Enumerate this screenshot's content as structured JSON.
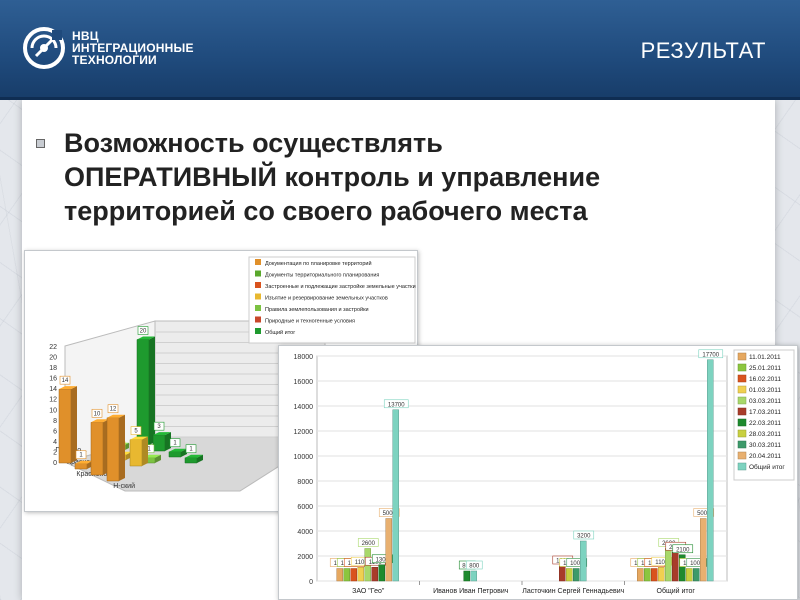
{
  "header": {
    "logo_lines": [
      "НВЦ",
      "ИНТЕГРАЦИОННЫЕ",
      "ТЕХНОЛОГИИ"
    ],
    "title": "РЕЗУЛЬТАТ"
  },
  "bullet": {
    "line1": "Возможность осуществлять",
    "line2_emphasis": "ОПЕРАТИВНЫЙ",
    "line2_rest": " контроль и управление",
    "line3": "территорией со своего рабочего места"
  },
  "chart_data": [
    {
      "type": "bar",
      "title": "",
      "xlabel": "",
      "ylabel": "",
      "ylim": [
        0,
        22
      ],
      "y_ticks": [
        0,
        2,
        4,
        6,
        8,
        10,
        12,
        14,
        16,
        18,
        20,
        22
      ],
      "categories": [
        "Гусиноо...",
        "Краснооз...",
        "Краснопол...",
        "Н-ский"
      ],
      "legend": [
        {
          "name": "Документация по планировке территорий",
          "color": "#e0902a"
        },
        {
          "name": "Документы территориального планирования",
          "color": "#5aa82c"
        },
        {
          "name": "Застроенные и подлежащие застройке земельные участки",
          "color": "#d9531e"
        },
        {
          "name": "Изъятие и резервирование земельных участков",
          "color": "#e8b830"
        },
        {
          "name": "Правила землепользования и застройки",
          "color": "#7cc242"
        },
        {
          "name": "Природные и техногенные условия",
          "color": "#c8472a"
        },
        {
          "name": "Общий итог",
          "color": "#1e9a2e"
        }
      ],
      "bars": [
        {
          "category": "Гусиноо...",
          "series": "Общий итог",
          "value": 20,
          "label": "20"
        },
        {
          "category": "Гусиноо...",
          "series": "Документация по планировке территорий",
          "value": 14,
          "label": "14"
        },
        {
          "category": "Гусиноо...",
          "series": "Изъятие и резервирование земельных участков",
          "value": 3,
          "label": "3"
        },
        {
          "category": "Гусиноо...",
          "series": "Правила землепользования и застройки",
          "value": 1,
          "label": "1"
        },
        {
          "category": "Краснооз...",
          "series": "Документация по планировке территорий",
          "value": 1,
          "label": "1"
        },
        {
          "category": "Краснооз...",
          "series": "Застроенные и подлежащие застройке земельные участки",
          "value": 5,
          "label": "5"
        },
        {
          "category": "Краснооз...",
          "series": "Изъятие и резервирование земельных участков",
          "value": 1,
          "label": "1"
        },
        {
          "category": "Краснооз...",
          "series": "Общий итог",
          "value": 3,
          "label": "3"
        },
        {
          "category": "Краснопол...",
          "series": "Документация по планировке территорий",
          "value": 10,
          "label": "10"
        },
        {
          "category": "Краснопол...",
          "series": "Правила землепользования и застройки",
          "value": 1,
          "label": "1"
        },
        {
          "category": "Краснопол...",
          "series": "Изъятие и резервирование земельных участков",
          "value": 5,
          "label": "5"
        },
        {
          "category": "Краснопол...",
          "series": "Общий итог",
          "value": 1,
          "label": "1"
        },
        {
          "category": "Н-ский",
          "series": "Документация по планировке территорий",
          "value": 12,
          "label": "12"
        },
        {
          "category": "Н-ский",
          "series": "Общий итог",
          "value": 1,
          "label": "1"
        }
      ]
    },
    {
      "type": "bar",
      "title": "",
      "xlabel": "",
      "ylabel": "",
      "ylim": [
        0,
        18000
      ],
      "y_ticks": [
        0,
        2000,
        4000,
        6000,
        8000,
        10000,
        12000,
        14000,
        16000,
        18000
      ],
      "categories": [
        "ЗАО \"Гео\"",
        "Иванов Иван Петрович",
        "Ласточкин Сергей Геннадьевич",
        "Общий итог"
      ],
      "legend_position": "right",
      "series": [
        {
          "name": "11.01.2011",
          "color": "#e6a860",
          "values": [
            1000,
            null,
            null,
            1000
          ]
        },
        {
          "name": "25.01.2011",
          "color": "#8cc63f",
          "values": [
            1000,
            null,
            null,
            1000
          ]
        },
        {
          "name": "16.02.2011",
          "color": "#d9531e",
          "values": [
            1000,
            null,
            null,
            1000
          ]
        },
        {
          "name": "01.03.2011",
          "color": "#f0d050",
          "values": [
            1100,
            null,
            null,
            1100
          ]
        },
        {
          "name": "03.03.2011",
          "color": "#a8d86a",
          "values": [
            2600,
            null,
            null,
            2600
          ]
        },
        {
          "name": "17.03.2011",
          "color": "#a83c2a",
          "values": [
            1100,
            null,
            1200,
            2300
          ]
        },
        {
          "name": "22.03.2011",
          "color": "#1e8a2e",
          "values": [
            1300,
            800,
            null,
            2100
          ]
        },
        {
          "name": "28.03.2011",
          "color": "#c8d040",
          "values": [
            null,
            null,
            1000,
            1000
          ]
        },
        {
          "name": "30.03.2011",
          "color": "#3d9a6a",
          "values": [
            null,
            null,
            1000,
            1000
          ]
        },
        {
          "name": "20.04.2011",
          "color": "#e8b070",
          "values": [
            5000,
            null,
            null,
            5000
          ]
        },
        {
          "name": "Общий итог",
          "color": "#7dd3c0",
          "values": [
            13700,
            800,
            3200,
            17700
          ]
        }
      ]
    }
  ]
}
